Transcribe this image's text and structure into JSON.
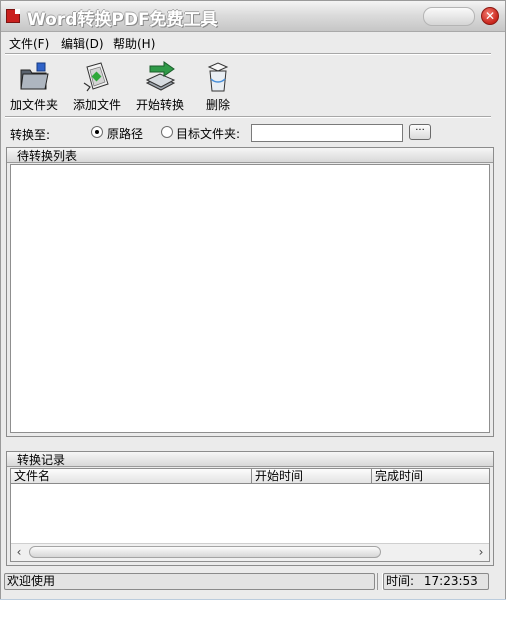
{
  "window": {
    "title": "Word转换PDF免费工具",
    "close_symbol": "✕"
  },
  "menu": {
    "items": [
      {
        "label": "文件(F)"
      },
      {
        "label": "编辑(D)"
      },
      {
        "label": "帮助(H)"
      }
    ]
  },
  "toolbar": {
    "add_folder": "加文件夹",
    "add_file": "添加文件",
    "start_convert": "开始转换",
    "delete": "删除"
  },
  "convert_to": {
    "label": "转换至:",
    "option_original": "原路径",
    "option_target": "目标文件夹:",
    "selected": "原路径",
    "target_value": "",
    "browse_label": "···"
  },
  "pending_list": {
    "title": "待转换列表"
  },
  "records": {
    "title": "转换记录",
    "columns": [
      "文件名",
      "开始时间",
      "完成时间"
    ]
  },
  "status": {
    "message": "欢迎使用",
    "time_label": "时间:",
    "time_value": "17:23:53"
  },
  "colors": {
    "window_bg": "#ebebeb",
    "close_button": "#c9251c",
    "app_icon": "#c9201e"
  }
}
